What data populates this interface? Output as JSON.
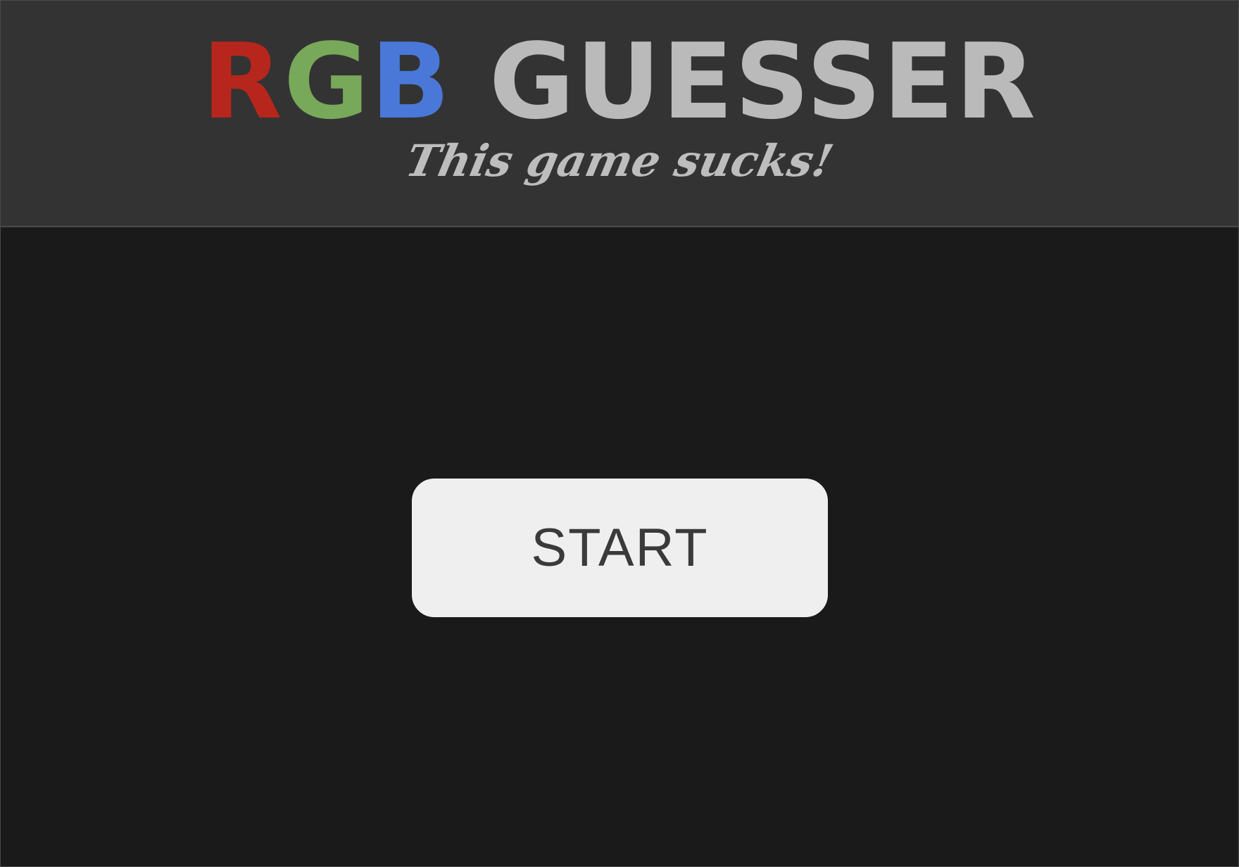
{
  "header": {
    "title_r": "R",
    "title_g": "G",
    "title_b": "B",
    "title_rest": " GUESSER",
    "subtitle": "This game sucks!"
  },
  "colors": {
    "red": "#b7261c",
    "green": "#78a85a",
    "blue": "#4a78d8",
    "title_gray": "#bababa",
    "subtitle_gray": "#bdbdbd",
    "header_bg": "#333333",
    "page_bg": "#1a1a1a",
    "button_bg": "#efefef",
    "button_text": "#3a3a3a"
  },
  "main": {
    "start_label": "START"
  }
}
